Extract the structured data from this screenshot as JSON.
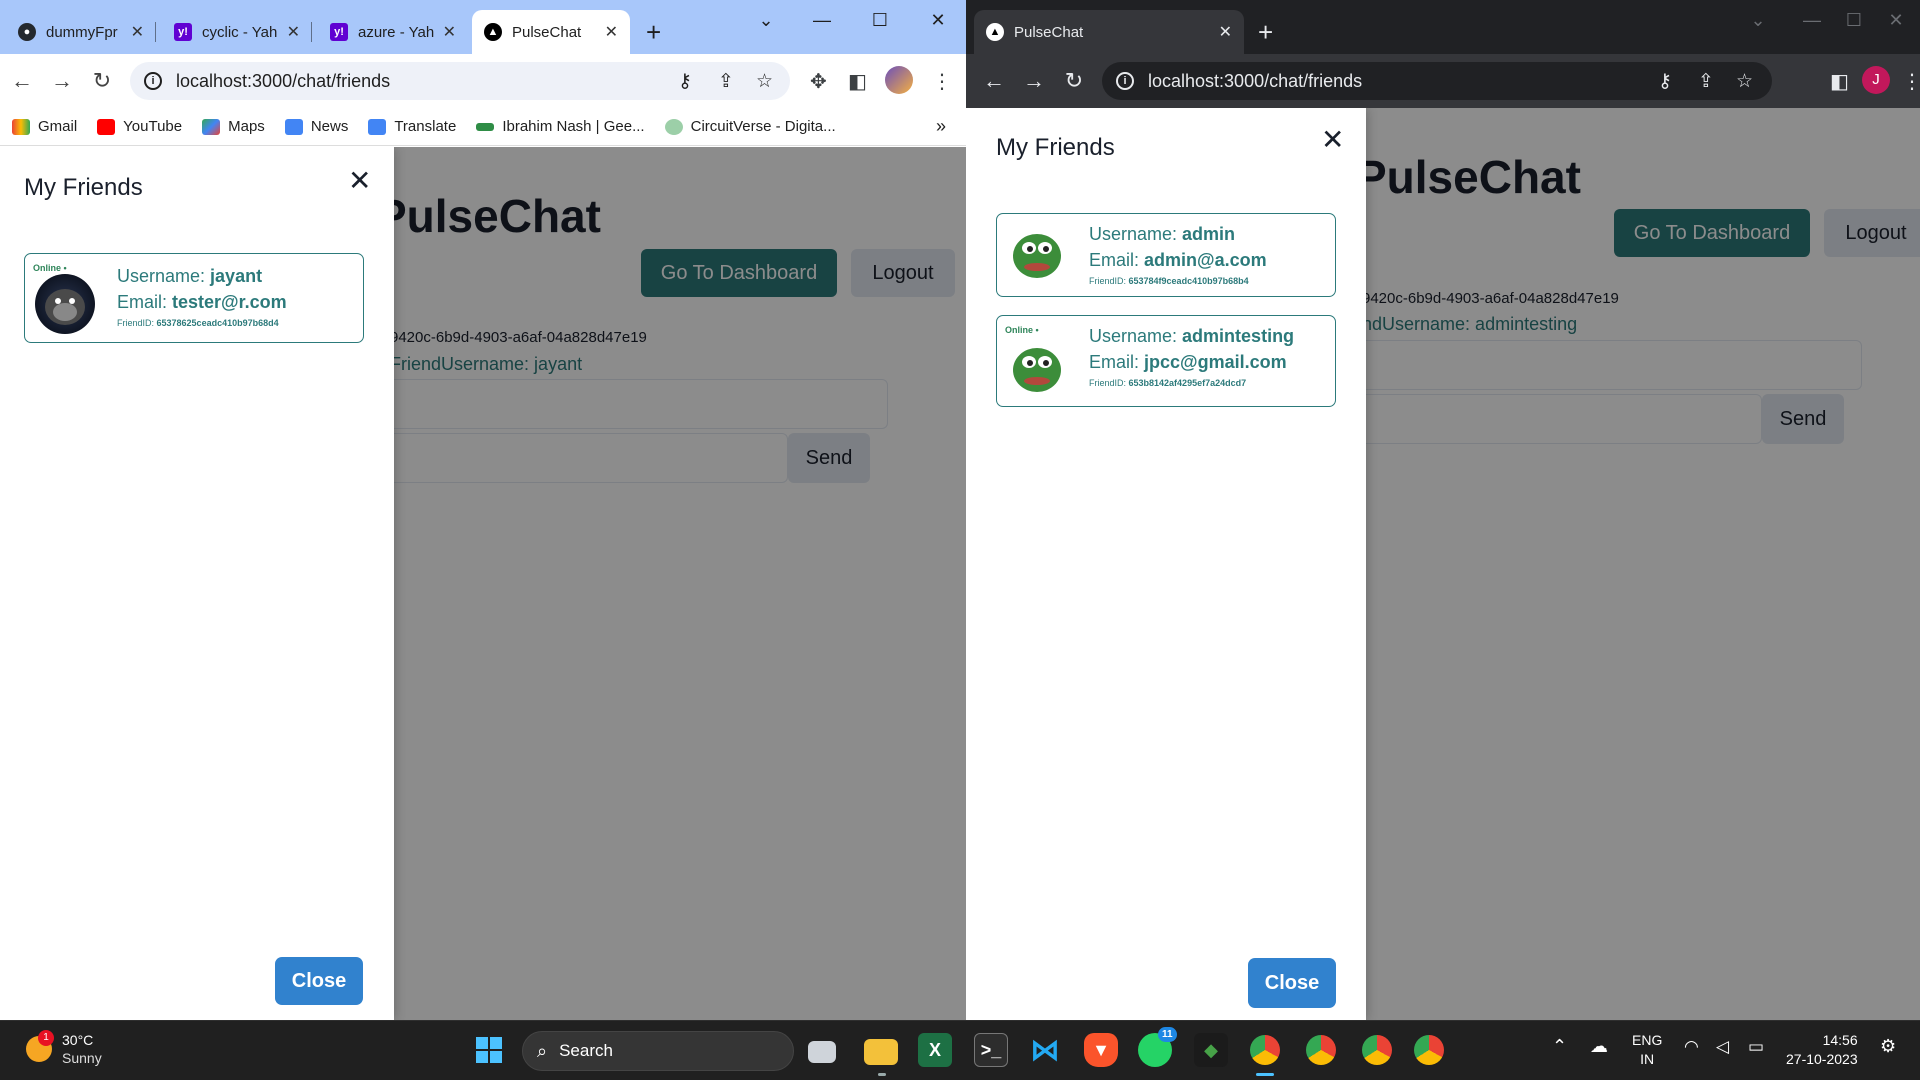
{
  "left_window": {
    "tabs": [
      {
        "title": "dummyFpr",
        "close": "✕"
      },
      {
        "title": "cyclic - Yah",
        "close": "✕"
      },
      {
        "title": "azure - Yah",
        "close": "✕"
      },
      {
        "title": "PulseChat",
        "close": "✕"
      }
    ],
    "url": "localhost:3000/chat/friends",
    "bookmarks": [
      "Gmail",
      "YouTube",
      "Maps",
      "News",
      "Translate",
      "Ibrahim Nash | Gee...",
      "CircuitVerse - Digita..."
    ],
    "bookmarks_more": "»",
    "page": {
      "title": "PulseChat",
      "dashboard_button": "Go To Dashboard",
      "logout_button": "Logout",
      "chat_id": "9420c-6b9d-4903-a6af-04a828d47e19",
      "friend_username": "FriendUsername: jayant",
      "send_button": "Send"
    },
    "drawer": {
      "title": "My Friends",
      "close_x": "✕",
      "friends": [
        {
          "online": "Online •",
          "username_label": "Username: ",
          "username": "jayant",
          "email_label": "Email: ",
          "email": "tester@r.com",
          "friendid_label": "FriendID: ",
          "friendid": "65378625ceadc410b97b68d4"
        }
      ],
      "close_button": "Close"
    }
  },
  "right_window": {
    "tabs": [
      {
        "title": "PulseChat",
        "close": "✕"
      }
    ],
    "url": "localhost:3000/chat/friends",
    "profile_initial": "J",
    "page": {
      "title": "PulseChat",
      "dashboard_button": "Go To Dashboard",
      "logout_button": "Logout",
      "chat_id": "9420c-6b9d-4903-a6af-04a828d47e19",
      "friend_username": "ndUsername: admintesting",
      "send_button": "Send"
    },
    "drawer": {
      "title": "My Friends",
      "close_x": "✕",
      "friends": [
        {
          "online": "",
          "username_label": "Username: ",
          "username": "admin",
          "email_label": "Email: ",
          "email": "admin@a.com",
          "friendid_label": "FriendID: ",
          "friendid": "653784f9ceadc410b97b68b4"
        },
        {
          "online": "Online •",
          "username_label": "Username: ",
          "username": "admintesting",
          "email_label": "Email: ",
          "email": "jpcc@gmail.com",
          "friendid_label": "FriendID: ",
          "friendid": "653b8142af4295ef7a24dcd7"
        }
      ],
      "close_button": "Close"
    }
  },
  "taskbar": {
    "weather_temp": "30°C",
    "weather_desc": "Sunny",
    "weather_badge": "1",
    "search_label": "Search",
    "whatsapp_badge": "11",
    "lang_1": "ENG",
    "lang_2": "IN",
    "time": "14:56",
    "date": "27-10-2023"
  },
  "colors": {
    "accent_teal": "#2c7a7b",
    "close_blue": "#3182ce",
    "chrome_light_tabbar": "#a8c7fa",
    "chrome_dark_tabbar": "#202124"
  }
}
